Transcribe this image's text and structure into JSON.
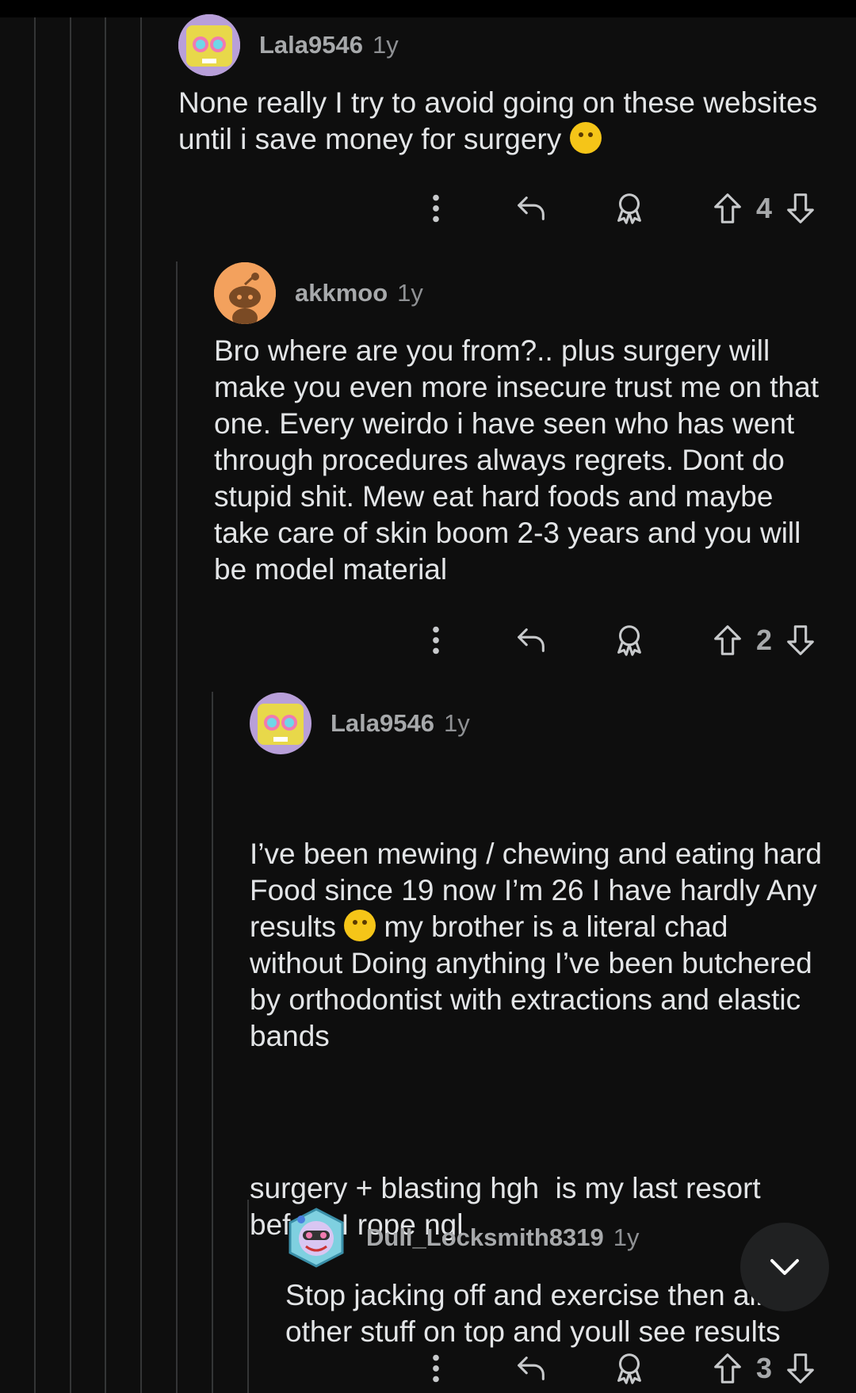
{
  "comments": [
    {
      "username": "Lala9546",
      "age": "1y",
      "paragraphs": [
        "None really I try to avoid going on these websites until i save money for surgery "
      ],
      "votes": "4",
      "avatar": "spongebob-glasses"
    },
    {
      "username": "akkmoo",
      "age": "1y",
      "paragraphs": [
        "Bro where are you from?.. plus surgery will make you even more insecure trust me on that one. Every weirdo i have seen who has went through procedures always regrets. Dont do stupid shit. Mew eat hard foods and maybe take care of skin boom 2-3 years and you will be model material"
      ],
      "votes": "2",
      "avatar": "default-snoo"
    },
    {
      "username": "Lala9546",
      "age": "1y",
      "paragraphs": [
        "I’ve been mewing / chewing and eating hard Food since 19 now I’m 26 I have hardly Any results ",
        " my brother is a literal chad without Doing anything I’ve been butchered by orthodontist with extractions and elastic bands",
        "surgery + blasting hgh  is my last resort before I rope ngl"
      ],
      "votes": "3",
      "avatar": "spongebob-glasses"
    },
    {
      "username": "Dull_Locksmith8319",
      "age": "1y",
      "paragraphs": [
        "Stop jacking off and exercise then ",
        "all the other stuff on top and youll see results"
      ],
      "avatar": "hex-nft"
    }
  ],
  "icons": {
    "more": "more-vertical-icon",
    "reply": "reply-icon",
    "award": "award-icon",
    "upvote": "upvote-icon",
    "downvote": "downvote-icon",
    "scroll": "chevron-down-icon"
  },
  "colors": {
    "background": "#0e0e0e",
    "text": "#e3e5e7",
    "muted": "#8f9194",
    "thread_line": "#343536"
  }
}
